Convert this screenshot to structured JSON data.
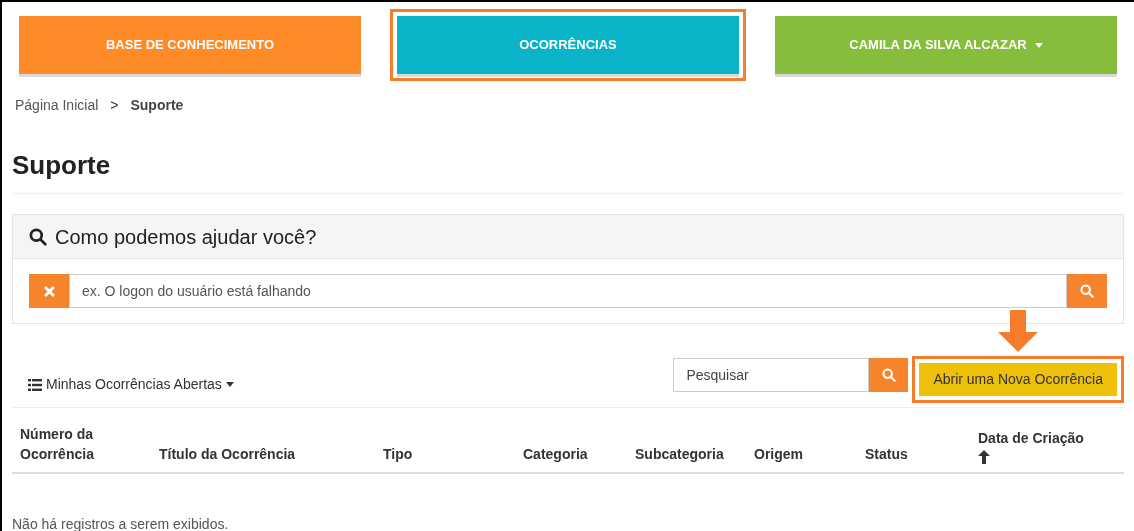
{
  "nav": [
    {
      "label": "BASE DE CONHECIMENTO",
      "color": "#fe8a28",
      "highlighted": false,
      "dropdown": false
    },
    {
      "label": "OCORRÊNCIAS",
      "color": "#0ab4c8",
      "highlighted": true,
      "dropdown": false
    },
    {
      "label": "CAMILA DA SILVA ALCAZAR",
      "color": "#86bd3c",
      "highlighted": false,
      "dropdown": true
    }
  ],
  "breadcrumb": [
    {
      "label": "Página Inicial",
      "current": false
    },
    {
      "label": "Suporte",
      "current": true
    }
  ],
  "breadcrumb_separator": ">",
  "page_title": "Suporte",
  "help_panel": {
    "title": "Como podemos ajudar você?",
    "placeholder": "ex. O logon do usuário está falhando"
  },
  "toolbar": {
    "view_menu": "Minhas Ocorrências Abertas",
    "search_placeholder": "Pesquisar",
    "new_button": "Abrir uma Nova Ocorrência",
    "new_button_highlighted": true
  },
  "table": {
    "columns": [
      {
        "label": "Número da Ocorrência",
        "sorted": false
      },
      {
        "label": "Título da Ocorrência",
        "sorted": false
      },
      {
        "label": "Tipo",
        "sorted": false
      },
      {
        "label": "Categoria",
        "sorted": false
      },
      {
        "label": "Subcategoria",
        "sorted": false
      },
      {
        "label": "Origem",
        "sorted": false
      },
      {
        "label": "Status",
        "sorted": false
      },
      {
        "label": "Data de Criação",
        "sorted": true
      }
    ],
    "empty_message": "Não há registros a serem exibidos."
  }
}
